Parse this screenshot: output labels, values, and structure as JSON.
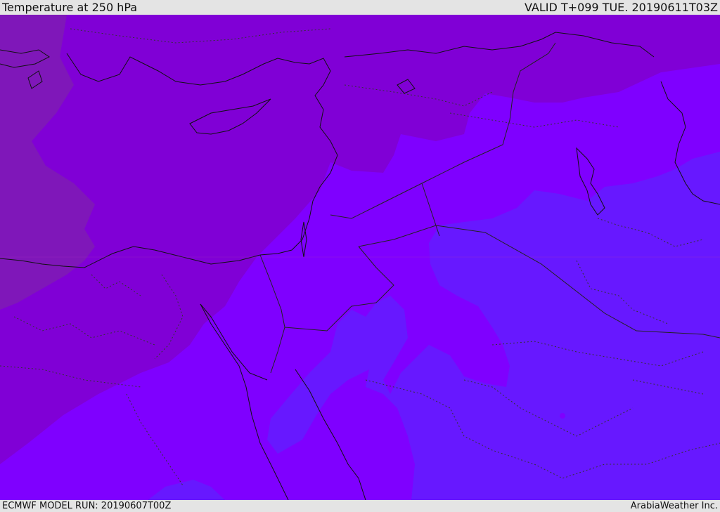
{
  "header": {
    "title": "Temperature at 250 hPa",
    "valid": "VALID T+099 TUE. 20190611T03Z"
  },
  "footer": {
    "model_run": "ECMWF MODEL RUN: 20190607T00Z",
    "credit": "ArabiaWeather Inc."
  },
  "map": {
    "field": "Temperature",
    "level": "250 hPa",
    "colors": {
      "band_coldest": "#7f17b9",
      "band_cold": "#8000d6",
      "band_mid": "#7f00ff",
      "band_warm": "#6718ff",
      "coastline": "#111111",
      "borders": "#222222"
    }
  }
}
